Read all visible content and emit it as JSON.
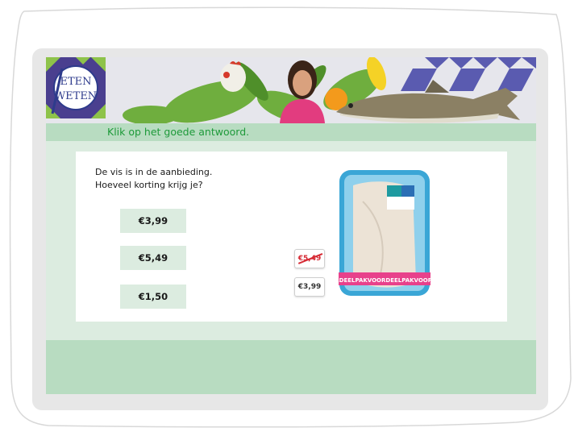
{
  "logo": {
    "line1": "ETEN",
    "line2": "WETEN"
  },
  "instruction": "Klik op het goede antwoord.",
  "question": {
    "line1": "De vis is in de aanbieding.",
    "line2": "Hoeveel korting krijg je?"
  },
  "answers": [
    {
      "label": "€3,99"
    },
    {
      "label": "€5,49"
    },
    {
      "label": "€1,50"
    }
  ],
  "price_tags": {
    "old": "€5,49",
    "new": "€3,99"
  },
  "package_band": "VOORDEELPAKVOORDEELPAKVOORDEEL",
  "colors": {
    "accent_green": "#1e9a3a",
    "panel_green": "#dcece0",
    "bar_green": "#b8dcc1",
    "price_red": "#d62b35"
  }
}
